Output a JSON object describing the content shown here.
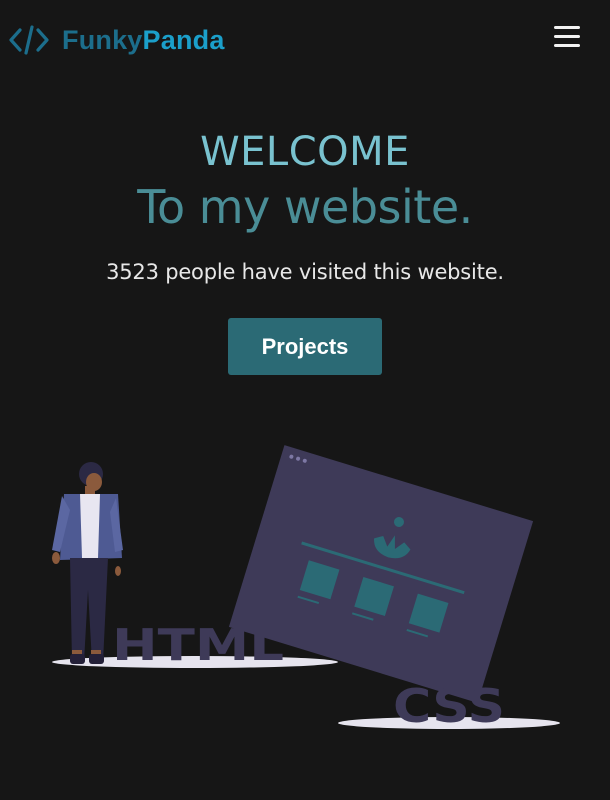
{
  "navbar": {
    "brand_part1": "Funky",
    "brand_part2": "Panda",
    "brand_icon": "code-icon",
    "menu_icon": "hamburger-menu-icon",
    "colors": {
      "brand_dark": "#1c6e8c",
      "brand_light": "#1b9fca"
    }
  },
  "hero": {
    "welcome": "WELCOME",
    "subtitle": "To my website.",
    "visitors": "3523 people have visited this website.",
    "projects_label": "Projects"
  },
  "illustration": {
    "html_label": "HTML",
    "css_label": "CSS",
    "colors": {
      "accent": "#2b6a75",
      "panel": "#3e3a58"
    }
  }
}
